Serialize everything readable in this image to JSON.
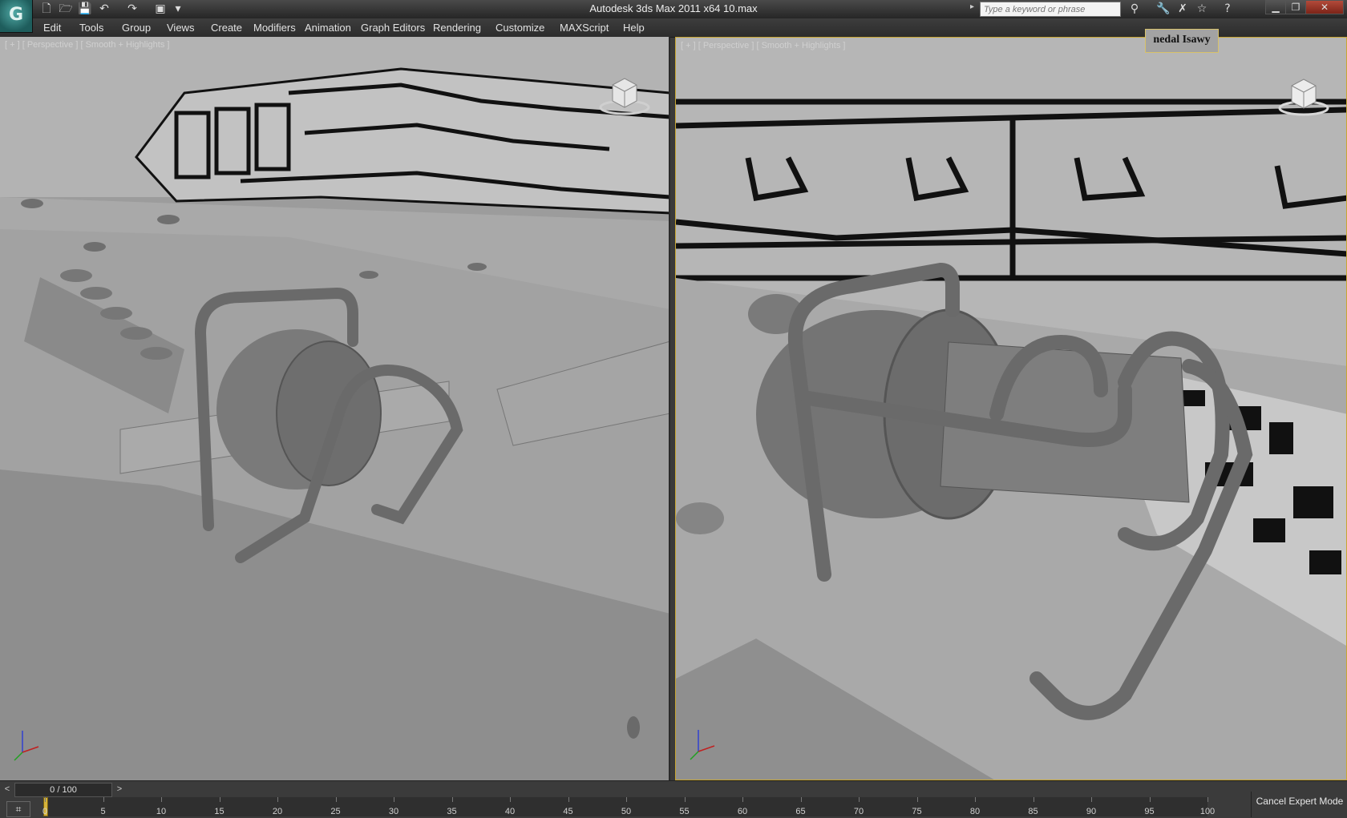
{
  "window": {
    "title": "Autodesk 3ds Max  2011 x64      10.max",
    "logo_glyph": "G",
    "minimize_glyph": "▁",
    "maximize_glyph": "❐",
    "close_glyph": "✕"
  },
  "quick_access": {
    "new_icon": "new-file-icon",
    "open_icon": "open-folder-icon",
    "save_icon": "save-icon",
    "undo_icon": "undo-icon",
    "redo_icon": "redo-icon",
    "project_icon": "project-folder-icon"
  },
  "search": {
    "placeholder": "Type a keyword or phrase"
  },
  "menus": [
    "Edit",
    "Tools",
    "Group",
    "Views",
    "Create",
    "Modifiers",
    "Animation",
    "Graph Editors",
    "Rendering",
    "Customize",
    "MAXScript",
    "Help"
  ],
  "viewports": {
    "left": {
      "label": "[ + ] [ Perspective ] [ Smooth + Highlights ]"
    },
    "right": {
      "label": "[ + ] [ Perspective ] [ Smooth + Highlights ]",
      "credit": "nedal Isawy",
      "active_border_color": "#c8a632"
    }
  },
  "timeline": {
    "frame_counter": "0 / 100",
    "prev_glyph": "<",
    "next_glyph": ">",
    "ticks": [
      "0",
      "5",
      "10",
      "15",
      "20",
      "25",
      "30",
      "35",
      "40",
      "45",
      "50",
      "55",
      "60",
      "65",
      "70",
      "75",
      "80",
      "85",
      "90",
      "95",
      "100"
    ]
  },
  "status": {
    "cancel_expert": "Cancel Expert Mode"
  },
  "colors": {
    "viewport_bg": "#9a9a9a",
    "ui_dark": "#3a3a3a",
    "timeslider": "#d6b43a"
  }
}
